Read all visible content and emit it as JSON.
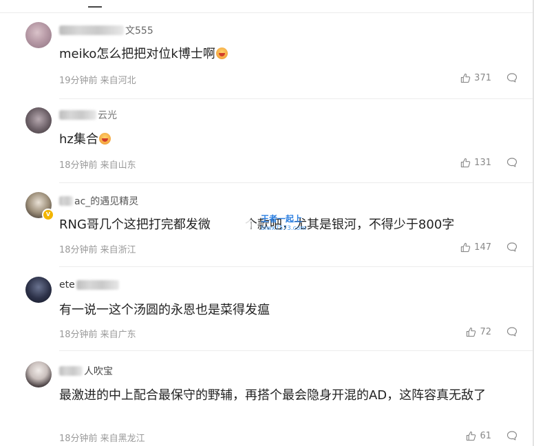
{
  "comments": [
    {
      "username": "文555",
      "content": "meiko怎么把把对位k博士啊",
      "emoji": "laughing-emoji",
      "meta": "19分钟前 来自河北",
      "likes": "371"
    },
    {
      "username": "云光",
      "content": "hz集合",
      "emoji": "laughing-emoji",
      "meta": "18分钟前 来自山东",
      "likes": "131"
    },
    {
      "username": "ac_的遇见精灵",
      "content_before": "RNG哥几个这把打完都发微",
      "content_after": "个款吧，尤其是银河，不得少于800字",
      "meta": "18分钟前 来自浙江",
      "likes": "147"
    },
    {
      "username": "ete",
      "content": "有一说一这个汤圆的永恩也是菜得发瘟",
      "meta": "18分钟前 来自广东",
      "likes": "72"
    },
    {
      "username": "人吹宝",
      "content": "最激进的中上配合最保守的野辅，再搭个最会隐身开混的AD，这阵容真无敌了",
      "meta": "18分钟前 来自黑龙江",
      "likes": "61"
    }
  ],
  "watermark": {
    "line1": "王者一起上",
    "line2": "blwx7573.com"
  },
  "colors": {
    "text": "#222222",
    "meta": "#999999",
    "icon": "#888888",
    "badge": "#f2b500",
    "watermark": "#2a7ee0"
  }
}
